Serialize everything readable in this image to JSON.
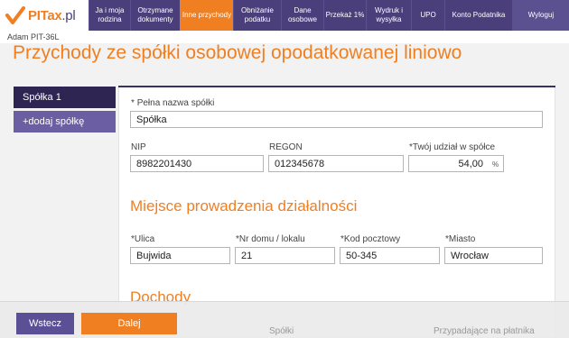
{
  "colors": {
    "brand_orange": "#f07f22",
    "brand_purple": "#4a3f7a",
    "dark_purple": "#2f2553"
  },
  "logo": {
    "text_main": "PITax",
    "text_suffix": ".pl",
    "icon": "checkmark-logo-icon"
  },
  "nav": {
    "items": [
      {
        "label": "Ja i moja rodzina"
      },
      {
        "label": "Otrzymane dokumenty"
      },
      {
        "label": "Inne przychody",
        "active": true
      },
      {
        "label": "Obniżanie podatku"
      },
      {
        "label": "Dane osobowe"
      },
      {
        "label": "Przekaż 1%"
      },
      {
        "label": "Wydruk i wysyłka"
      },
      {
        "label": "UPO"
      },
      {
        "label": "Konto Podatnika"
      }
    ],
    "logout": "Wyloguj"
  },
  "user": {
    "name": "Adam PIT-36L"
  },
  "page": {
    "title": "Przychody ze spółki osobowej opodatkowanej liniowo"
  },
  "sidebar": {
    "company_tab": "Spółka 1",
    "add_tab": "+dodaj spółkę"
  },
  "form": {
    "full_name": {
      "label": "Pełna nazwa spółki",
      "required": "*",
      "value": "Spółka"
    },
    "nip": {
      "label": "NIP",
      "value": "8982201430"
    },
    "regon": {
      "label": "REGON",
      "value": "012345678"
    },
    "share": {
      "label": "Twój udział w spółce",
      "required": "*",
      "value": "54,00",
      "unit": "%"
    },
    "location_title": "Miejsce prowadzenia działalności",
    "street": {
      "label": "Ulica",
      "required": "*",
      "value": "Bujwida"
    },
    "house": {
      "label": "Nr domu / lokalu",
      "required": "*",
      "value": "21"
    },
    "postal": {
      "label": "Kod pocztowy",
      "required": "*",
      "value": "50-345"
    },
    "city": {
      "label": "Miasto",
      "required": "*",
      "value": "Wrocław"
    },
    "income_title": "Dochody",
    "col_company": "Spółki",
    "col_taxpayer": "Przypadające na płatnika"
  },
  "actions": {
    "back": "Wstecz",
    "next": "Dalej"
  }
}
